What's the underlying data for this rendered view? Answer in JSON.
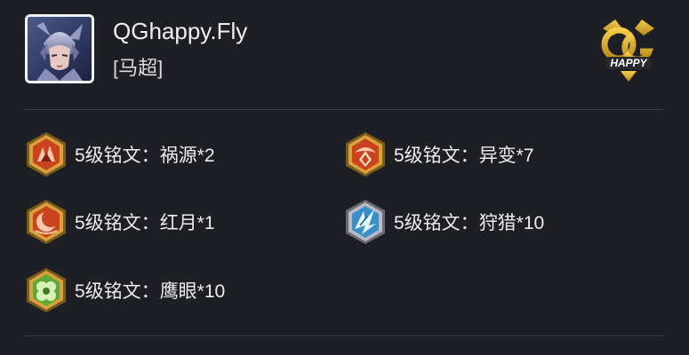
{
  "player": {
    "name": "QGhappy.Fly",
    "hero": "[马超]"
  },
  "logo": {
    "icon": "qghappy-team-logo",
    "text": "HAPPY"
  },
  "runes": [
    {
      "level": "5级铭文：",
      "name": "祸源*2",
      "icon": "huoyuan-rune-icon",
      "color": "#c9431e"
    },
    {
      "level": "5级铭文：",
      "name": "异变*7",
      "icon": "yibian-rune-icon",
      "color": "#c9431e"
    },
    {
      "level": "5级铭文：",
      "name": "红月*1",
      "icon": "hongyue-rune-icon",
      "color": "#c9431e"
    },
    {
      "level": "5级铭文：",
      "name": "狩猎*10",
      "icon": "shoulie-rune-icon",
      "color": "#3a8fc9"
    },
    {
      "level": "5级铭文：",
      "name": "鹰眼*10",
      "icon": "yingyan-rune-icon",
      "color": "#5fa83a"
    }
  ]
}
